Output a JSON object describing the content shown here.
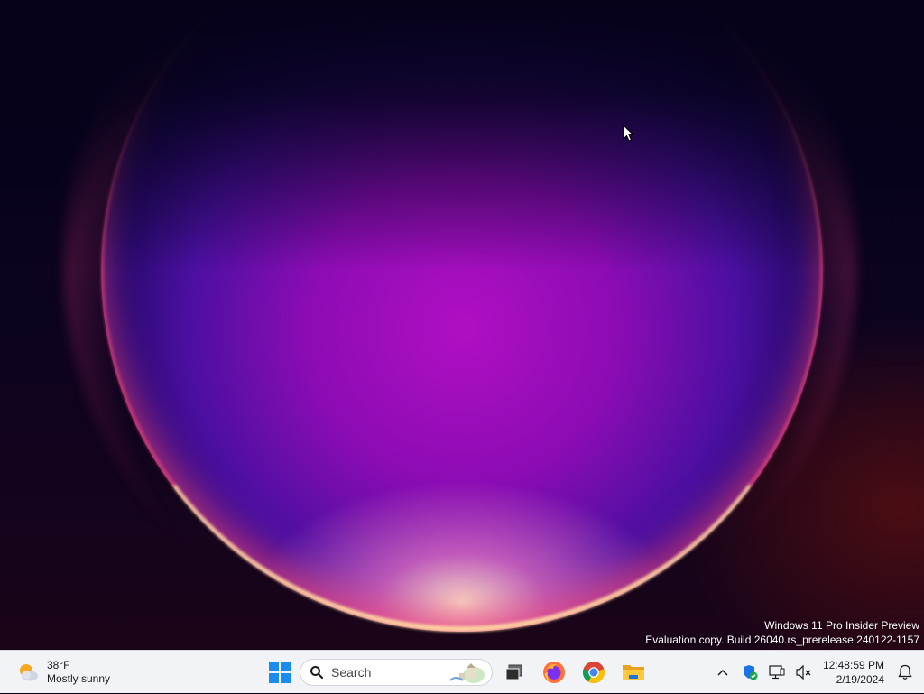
{
  "desktop": {
    "watermark_line1": "Windows 11 Pro Insider Preview",
    "watermark_line2": "Evaluation copy. Build 26040.rs_prerelease.240122-1157"
  },
  "taskbar": {
    "weather": {
      "temp": "38°F",
      "condition": "Mostly sunny",
      "icon": "partly-sunny-icon"
    },
    "search": {
      "placeholder": "Search",
      "icon": "search-icon"
    },
    "apps": [
      {
        "name": "start-button",
        "icon": "windows-logo-icon"
      },
      {
        "name": "task-view-button",
        "icon": "task-view-icon"
      },
      {
        "name": "firefox-button",
        "icon": "firefox-icon"
      },
      {
        "name": "chrome-button",
        "icon": "chrome-icon"
      },
      {
        "name": "file-explorer-button",
        "icon": "folder-icon"
      }
    ],
    "tray": {
      "icons": [
        "chevron-up-icon",
        "security-shield-icon",
        "network-icon",
        "volume-muted-icon"
      ],
      "time": "12:48:59 PM",
      "date": "2/19/2024",
      "notification_icon": "bell-icon"
    }
  },
  "colors": {
    "taskbar_bg": "#f1f3f6",
    "accent_blue": "#0078d4"
  }
}
